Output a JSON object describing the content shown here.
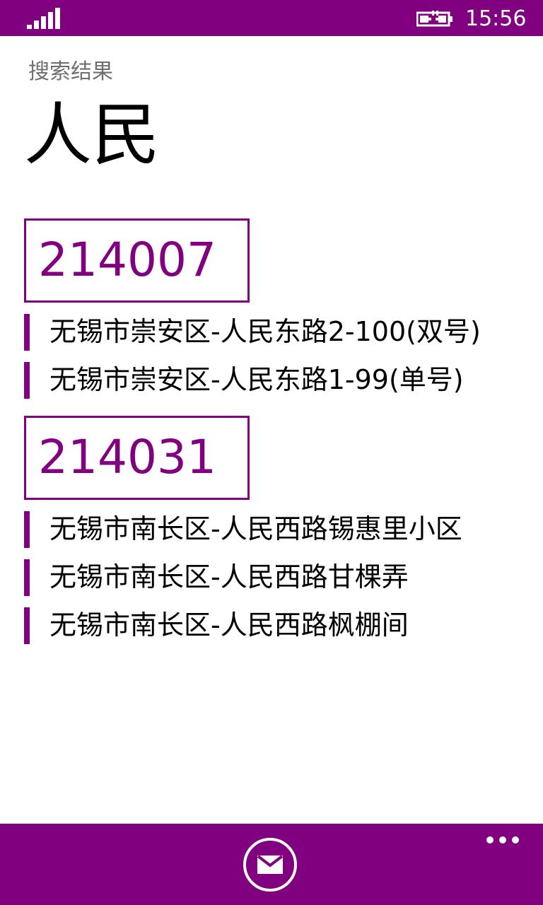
{
  "status_bar": {
    "time": "15:56"
  },
  "app": {
    "title": "搜索结果"
  },
  "page": {
    "title": "人民"
  },
  "results": [
    {
      "code": "214007",
      "items": [
        "无锡市崇安区-人民东路2-100(双号)",
        "无锡市崇安区-人民东路1-99(单号)"
      ]
    },
    {
      "code": "214031",
      "items": [
        "无锡市南长区-人民西路锡惠里小区",
        "无锡市南长区-人民西路甘棵弄",
        "无锡市南长区-人民西路枫棚间"
      ]
    }
  ],
  "app_bar": {
    "icons": [
      "mail-icon",
      "more-icon"
    ]
  },
  "theme": {
    "accent": "#800080",
    "background": "#ffffff"
  }
}
